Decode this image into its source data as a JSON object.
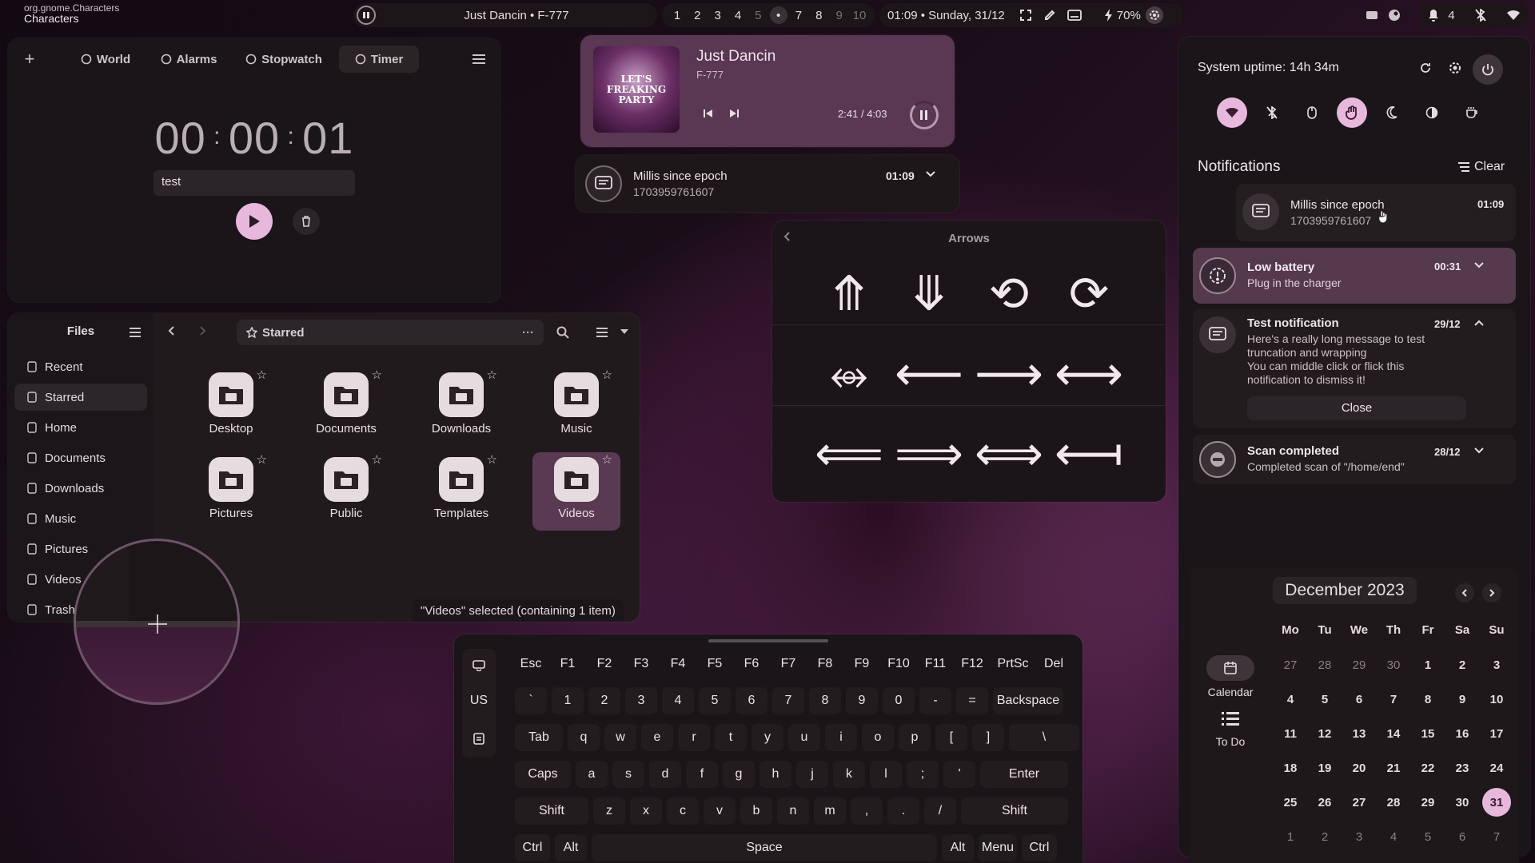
{
  "topbar": {
    "app_id": "org.gnome.Characters",
    "app_name": "Characters",
    "media_title": "Just Dancin • F-777",
    "workspaces": [
      "1",
      "2",
      "3",
      "4",
      "5",
      "•",
      "7",
      "8",
      "9",
      "10"
    ],
    "clock": "01:09 • Sunday, 31/12",
    "battery": "70%",
    "notif_count": "4"
  },
  "clocks": {
    "tabs": [
      "World",
      "Alarms",
      "Stopwatch",
      "Timer"
    ],
    "active_tab": "Timer",
    "time_h": "00",
    "time_m": "00",
    "time_s": "01",
    "label_value": "test"
  },
  "media": {
    "album_text": "LET'S FREAKING PARTY",
    "title": "Just Dancin",
    "artist": "F-777",
    "position": "2:41",
    "separator": "/",
    "duration": "4:03"
  },
  "popup_notif": {
    "title": "Millis since epoch",
    "body": "1703959761607",
    "time": "01:09"
  },
  "characters": {
    "header": "Arrows",
    "glyphs": [
      "⤊",
      "⤋",
      "⟲",
      "⟳",
      "⥈",
      "⟵",
      "⟶",
      "⟷",
      "⟸",
      "⟹",
      "⟺",
      "⟻"
    ]
  },
  "files": {
    "title": "Files",
    "location": "Starred",
    "sidebar": [
      {
        "label": "Recent",
        "icon": "clock-icon"
      },
      {
        "label": "Starred",
        "icon": "star-icon"
      },
      {
        "label": "Home",
        "icon": "home-icon"
      },
      {
        "label": "Documents",
        "icon": "document-icon"
      },
      {
        "label": "Downloads",
        "icon": "download-icon"
      },
      {
        "label": "Music",
        "icon": "music-icon"
      },
      {
        "label": "Pictures",
        "icon": "picture-icon"
      },
      {
        "label": "Videos",
        "icon": "video-icon"
      },
      {
        "label": "Trash",
        "icon": "trash-icon"
      }
    ],
    "items": [
      "Desktop",
      "Documents",
      "Downloads",
      "Music",
      "Pictures",
      "Public",
      "Templates",
      "Videos"
    ],
    "status": "\"Videos\" selected (containing 1 item)"
  },
  "keyboard": {
    "layout": "US",
    "rows": [
      [
        "Esc",
        "F1",
        "F2",
        "F3",
        "F4",
        "F5",
        "F6",
        "F7",
        "F8",
        "F9",
        "F10",
        "F11",
        "F12",
        "PrtSc",
        "Del"
      ],
      [
        "`",
        "1",
        "2",
        "3",
        "4",
        "5",
        "6",
        "7",
        "8",
        "9",
        "0",
        "-",
        "=",
        "Backspace"
      ],
      [
        "Tab",
        "q",
        "w",
        "e",
        "r",
        "t",
        "y",
        "u",
        "i",
        "o",
        "p",
        "[",
        "]",
        "\\"
      ],
      [
        "Caps",
        "a",
        "s",
        "d",
        "f",
        "g",
        "h",
        "j",
        "k",
        "l",
        ";",
        "'",
        "Enter"
      ],
      [
        "Shift",
        "z",
        "x",
        "c",
        "v",
        "b",
        "n",
        "m",
        ",",
        ".",
        "/",
        "Shift"
      ],
      [
        "Ctrl",
        "Alt",
        "Space",
        "Alt",
        "Menu",
        "Ctrl"
      ]
    ]
  },
  "sidebar_panel": {
    "uptime": "System uptime: 14h 34m",
    "notifications_title": "Notifications",
    "clear_label": "Clear",
    "notifications": [
      {
        "title": "Millis since epoch",
        "body": "1703959761607",
        "time": "01:09"
      },
      {
        "title": "Low battery",
        "body": "Plug in the charger",
        "time": "00:31"
      },
      {
        "title": "Test notification",
        "body": "Here's a really long message to test truncation and wrapping\nYou can middle click or flick this notification to dismiss it!",
        "time": "29/12",
        "action": "Close"
      },
      {
        "title": "Scan completed",
        "body": "Completed scan of \"/home/end\"",
        "time": "28/12"
      }
    ],
    "calendar": {
      "month": "December 2023",
      "weekdays": [
        "Mo",
        "Tu",
        "We",
        "Th",
        "Fr",
        "Sa",
        "Su"
      ],
      "days": [
        [
          "27",
          "28",
          "29",
          "30",
          "1",
          "2",
          "3"
        ],
        [
          "4",
          "5",
          "6",
          "7",
          "8",
          "9",
          "10"
        ],
        [
          "11",
          "12",
          "13",
          "14",
          "15",
          "16",
          "17"
        ],
        [
          "18",
          "19",
          "20",
          "21",
          "22",
          "23",
          "24"
        ],
        [
          "25",
          "26",
          "27",
          "28",
          "29",
          "30",
          "31"
        ],
        [
          "1",
          "2",
          "3",
          "4",
          "5",
          "6",
          "7"
        ]
      ],
      "today": "31",
      "side_tabs": [
        "Calendar",
        "To Do"
      ]
    }
  },
  "colors": {
    "accent": "#e7b8dc",
    "panel": "#1b1619",
    "surface": "#2a2326"
  }
}
